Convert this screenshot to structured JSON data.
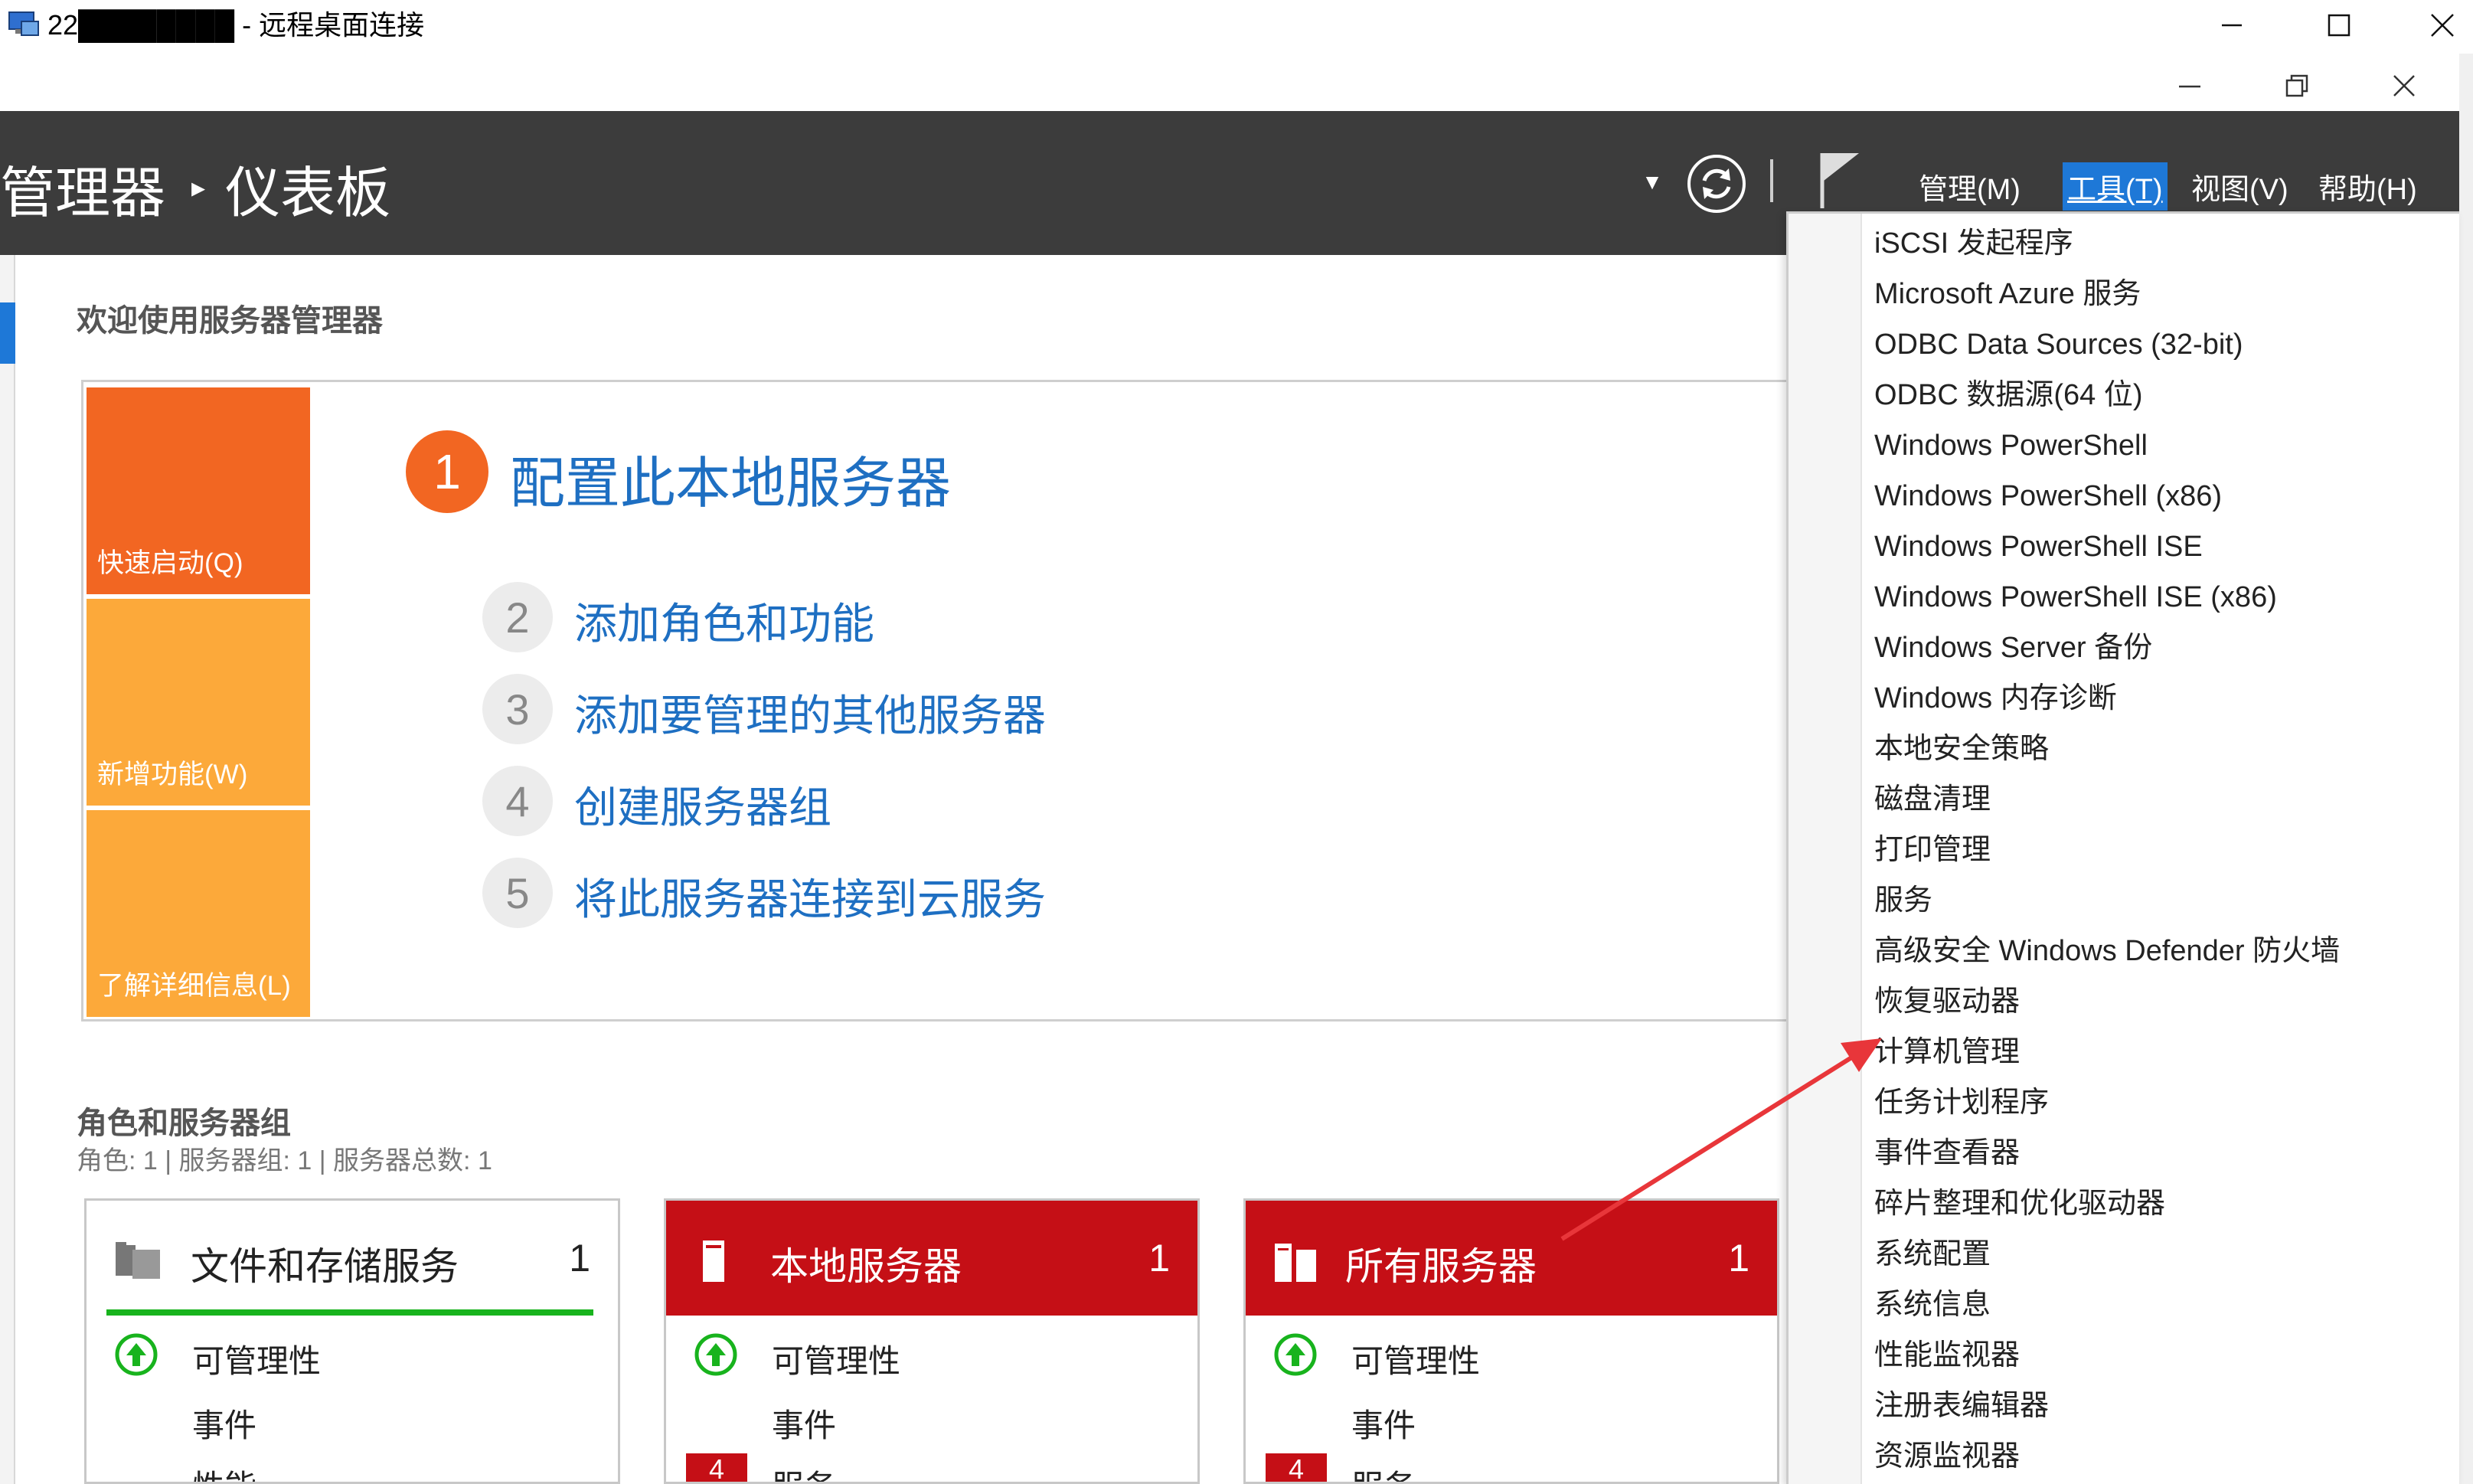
{
  "rdp": {
    "title": "22████████ - 远程桌面连接"
  },
  "header": {
    "breadcrumb_parent": "管理器",
    "breadcrumb_current": "仪表板"
  },
  "menu": {
    "manage": "管理(M)",
    "tools": "工具(T)",
    "view": "视图(V)",
    "help": "帮助(H)"
  },
  "welcome": {
    "title": "欢迎使用服务器管理器",
    "tiles": [
      "快速启动(Q)",
      "新增功能(W)",
      "了解详细信息(L)"
    ],
    "steps": [
      {
        "num": "1",
        "label": "配置此本地服务器"
      },
      {
        "num": "2",
        "label": "添加角色和功能"
      },
      {
        "num": "3",
        "label": "添加要管理的其他服务器"
      },
      {
        "num": "4",
        "label": "创建服务器组"
      },
      {
        "num": "5",
        "label": "将此服务器连接到云服务"
      }
    ]
  },
  "roles": {
    "title": "角色和服务器组",
    "subtitle": "角色: 1 | 服务器组: 1 | 服务器总数: 1",
    "cards": [
      {
        "name": "文件和存储服务",
        "count": "1",
        "rows": [
          "可管理性",
          "事件",
          "性能"
        ]
      },
      {
        "name": "本地服务器",
        "count": "1",
        "rows": [
          "可管理性",
          "事件",
          "服务"
        ],
        "badge": "4"
      },
      {
        "name": "所有服务器",
        "count": "1",
        "rows": [
          "可管理性",
          "事件",
          "服务"
        ],
        "badge": "4"
      }
    ]
  },
  "tools_menu": {
    "items": [
      "iSCSI 发起程序",
      "Microsoft Azure 服务",
      "ODBC Data Sources (32-bit)",
      "ODBC 数据源(64 位)",
      "Windows PowerShell",
      "Windows PowerShell (x86)",
      "Windows PowerShell ISE",
      "Windows PowerShell ISE (x86)",
      "Windows Server 备份",
      "Windows 内存诊断",
      "本地安全策略",
      "磁盘清理",
      "打印管理",
      "服务",
      "高级安全 Windows Defender 防火墙",
      "恢复驱动器",
      "计算机管理",
      "任务计划程序",
      "事件查看器",
      "碎片整理和优化驱动器",
      "系统配置",
      "系统信息",
      "性能监视器",
      "注册表编辑器",
      "资源监视器"
    ]
  },
  "colors": {
    "header_bg": "#3c3c3c",
    "accent_blue": "#1e78d7",
    "link_blue": "#1e6fc2",
    "tile_orange": "#f26622",
    "tile_amber": "#fca93a",
    "alert_red": "#c50f16",
    "ok_green": "#18b31d",
    "annotation_arrow": "#e8363a"
  }
}
